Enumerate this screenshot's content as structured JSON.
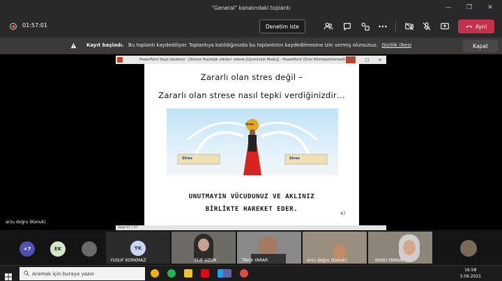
{
  "window": {
    "title": "\"General\" kanalındaki toplantı"
  },
  "toolbar": {
    "timer": "01:57:01",
    "control_button": "Denetim iste",
    "leave_button": "Ayrıl"
  },
  "banner": {
    "bold": "Kayıt başladı.",
    "text": "Bu toplantı kaydediliyor. Toplantıya katıldığınızda bu toplantının kaydedilmesine izin vermiş olursunuz.",
    "link": "Gizlilik ilkesi",
    "close_button": "Kapat"
  },
  "ppt": {
    "title": "PowerPoint Slayt Gösterisi - [Stresin fizyolojik etkileri- edene [Uyumluluk Modu]] - PowerPoint (Ürün Etkinleştirilemedi)",
    "slide_line1": "Zararlı olan stres değil –",
    "slide_line2": "Zararlı olan strese nasıl tepki verdiğinizdir…",
    "sub_line1": "UNUTMAYIN VÜCUDUNUZ VE AKLINIZ",
    "sub_line2": "BİRLİKTE HAREKET EDER.",
    "labels": [
      "Stres",
      "Stres",
      "Stres"
    ],
    "slide_number": "47",
    "status": "Slayt 47 / 47"
  },
  "presenter": "arzu doğru (Konuk)",
  "participants": [
    {
      "name": "+7"
    },
    {
      "name": "EK"
    },
    {
      "name": "YUSUF KORKMAZ",
      "initials": "YK"
    },
    {
      "name": "ELIF UZUN"
    },
    {
      "name": "TAHA YARAR"
    },
    {
      "name": "arzu doğru (Konuk)"
    },
    {
      "name": "BANU YAMAN"
    }
  ],
  "taskbar": {
    "search_placeholder": "Aramak için buraya yazın",
    "time": "16:58",
    "date": "3.06.2021"
  },
  "colors": {
    "leave": "#c4314b",
    "toolbar": "#292929",
    "banner": "#3b3a39"
  }
}
